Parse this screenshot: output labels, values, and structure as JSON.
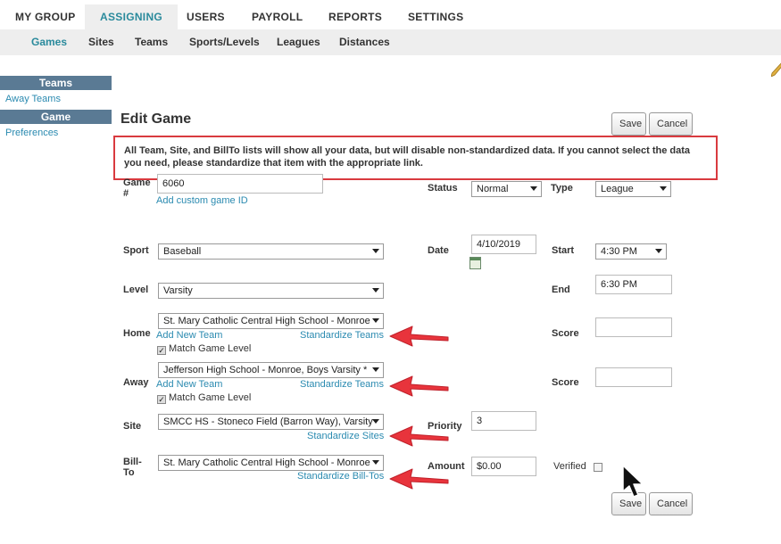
{
  "topnav": [
    "MY GROUP",
    "ASSIGNING",
    "USERS",
    "PAYROLL",
    "REPORTS",
    "SETTINGS"
  ],
  "subnav": [
    "Games",
    "Sites",
    "Teams",
    "Sports/Levels",
    "Leagues",
    "Distances"
  ],
  "sidebar": {
    "teams_header": "Teams",
    "away_teams": "Away Teams",
    "game_header": "Game",
    "preferences": "Preferences"
  },
  "page_title": "Edit Game",
  "buttons": {
    "save": "Save",
    "cancel": "Cancel"
  },
  "notice": "All Team, Site, and BillTo lists will show all your data, but will disable non-standardized data. If you cannot select the data you need, please standardize that item with the appropriate link.",
  "form": {
    "game_label": "Game #",
    "game_value": "6060",
    "add_custom_id": "Add custom game ID",
    "status_label": "Status",
    "status_value": "Normal",
    "type_label": "Type",
    "type_value": "League",
    "sport_label": "Sport",
    "sport_value": "Baseball",
    "date_label": "Date",
    "date_value": "4/10/2019",
    "start_label": "Start",
    "start_value": "4:30 PM",
    "level_label": "Level",
    "level_value": "Varsity",
    "end_label": "End",
    "end_value": "6:30 PM",
    "home_label": "Home",
    "home_value": "St. Mary Catholic Central High School - Monroe",
    "add_new_team": "Add New Team",
    "standardize_teams": "Standardize Teams",
    "match_game_level": "Match Game Level",
    "score_label": "Score",
    "away_label": "Away",
    "away_value": "Jefferson High School - Monroe, Boys Varsity *",
    "site_label": "Site",
    "site_value": "SMCC HS - Stoneco Field (Barron Way), Varsity",
    "standardize_sites": "Standardize Sites",
    "priority_label": "Priority",
    "priority_value": "3",
    "billto_label": "Bill-To",
    "billto_value": "St. Mary Catholic Central High School - Monroe",
    "standardize_billto": "Standardize Bill-Tos",
    "amount_label": "Amount",
    "amount_value": "$0.00",
    "verified_label": "Verified"
  },
  "colors": {
    "accent": "#2a8a9c",
    "link": "#2a8ab0",
    "sidebar_header": "#5a7a94",
    "notice_border": "#d93a3f",
    "arrow": "#e8343c"
  }
}
